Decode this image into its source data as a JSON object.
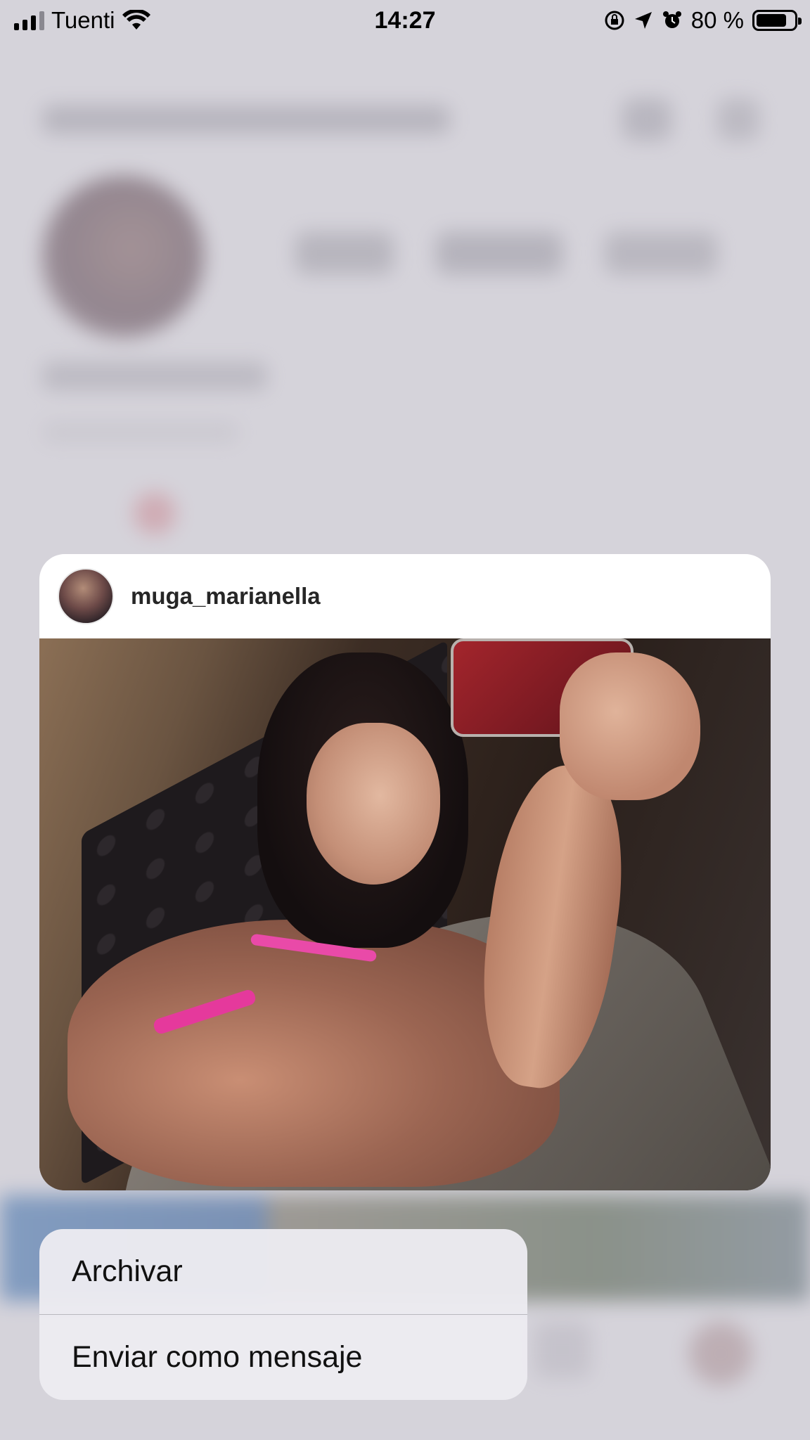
{
  "status_bar": {
    "carrier": "Tuenti",
    "time": "14:27",
    "battery_percent": "80 %",
    "battery_level": 0.8,
    "icons": [
      "signal-icon",
      "wifi-icon",
      "rotation-lock-icon",
      "location-arrow-icon",
      "alarm-icon",
      "battery-icon"
    ]
  },
  "preview_card": {
    "username": "muga_marianella",
    "avatar": "avatar",
    "image": "post-photo"
  },
  "context_menu": {
    "items": [
      {
        "label": "Archivar"
      },
      {
        "label": "Enviar como mensaje"
      }
    ]
  },
  "colors": {
    "background": "#d4d2d8",
    "card": "#ffffff",
    "menu": "#ecebf0",
    "text": "#111111"
  }
}
